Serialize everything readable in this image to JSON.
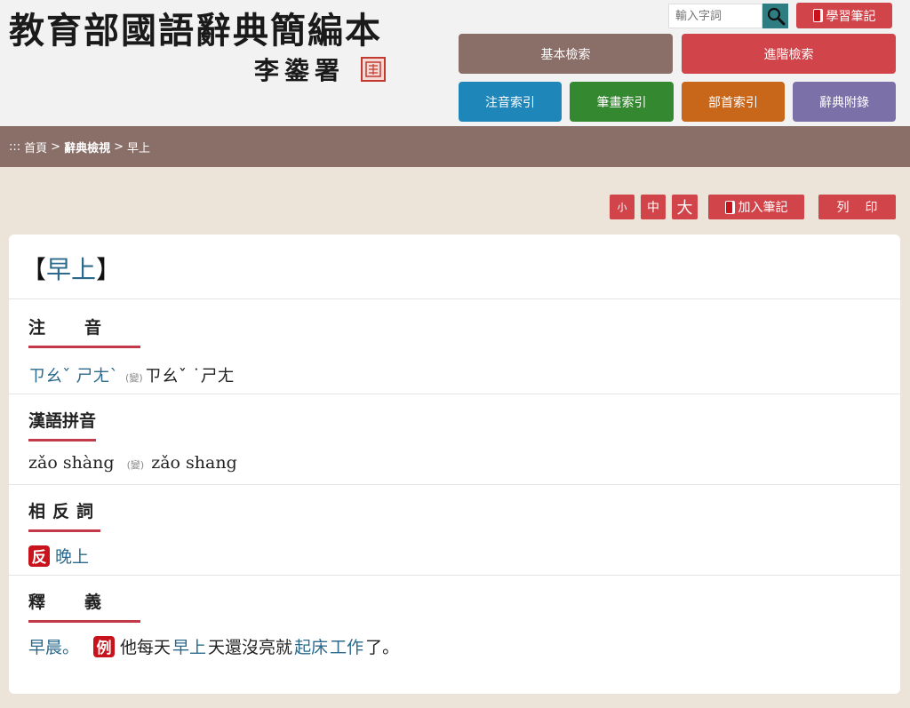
{
  "header": {
    "title": "教育部國語辭典簡編本",
    "signature": "李鍌署",
    "search_placeholder": "輸入字詞",
    "study_notes_label": "學習筆記"
  },
  "nav": {
    "basic_search": "基本檢索",
    "advanced_search": "進階檢索",
    "zhuyin_index": "注音索引",
    "stroke_index": "筆畫索引",
    "radical_index": "部首索引",
    "appendix": "辭典附錄"
  },
  "breadcrumb": {
    "prefix": ":::",
    "home": "首頁",
    "dictionary_view": "辭典檢視",
    "current": "早上",
    "separator": ">"
  },
  "tools": {
    "font_small": "小",
    "font_medium": "中",
    "font_large": "大",
    "add_note": "加入筆記",
    "print": "列印"
  },
  "entry": {
    "bracket_open": "【",
    "word": "早上",
    "bracket_close": "】",
    "sections": {
      "zhuyin_label": "注音",
      "pinyin_label": "漢語拼音",
      "antonym_label": "相反詞",
      "definition_label": "釋義"
    },
    "zhuyin": {
      "primary": "ㄗㄠˇ ㄕㄤˋ",
      "variant_mark": "(變)",
      "variant": "ㄗㄠˇ ˙ㄕㄤ"
    },
    "pinyin": {
      "primary": "zǎo shàng",
      "variant_mark": "(變)",
      "variant": "zǎo shang"
    },
    "antonym": {
      "tag": "反",
      "word": "晚上"
    },
    "definition": {
      "text": "早晨。",
      "example_tag": "例",
      "ex_part1": "他每天",
      "ex_link1": "早上",
      "ex_part2": "天還沒亮就",
      "ex_link2": "起床",
      "ex_part3": "工作",
      "ex_part4": "了。"
    }
  },
  "colors": {
    "brown": "#8a6e68",
    "red": "#d0444a",
    "blue": "#1e86b8",
    "green": "#34882f",
    "orange": "#c8661a",
    "purple": "#7b71a8",
    "link": "#2b6a8c"
  }
}
